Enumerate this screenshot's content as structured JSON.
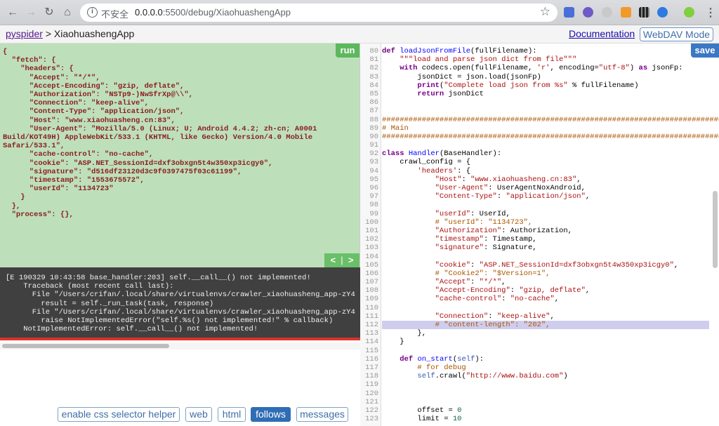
{
  "browser": {
    "security_label": "不安全",
    "url_host": "0.0.0.0",
    "url_rest": ":5500/debug/XiaohuashengApp",
    "extensions": [
      "jh-extension-icon",
      "w-extension-icon",
      "gear-extension-icon",
      "orange-extension-icon",
      "qr-code-extension-icon",
      "blue-globe-extension-icon",
      "profile-avatar-icon"
    ]
  },
  "header": {
    "breadcrumb_root": "pyspider",
    "breadcrumb_sep": ">",
    "project_name": "XiaohuashengApp",
    "documentation_link": "Documentation",
    "webdav_button": "WebDAV Mode"
  },
  "task_panel": {
    "run_label": "run",
    "pager_label": "<  |  >",
    "json_lines": [
      "{",
      "  \"fetch\": {",
      "    \"headers\": {",
      "      \"Accept\": \"*/*\",",
      "      \"Accept-Encoding\": \"gzip, deflate\",",
      "      \"Authorization\": \"NSTp9-)NwSfrXp@\\\\\",",
      "      \"Connection\": \"keep-alive\",",
      "      \"Content-Type\": \"application/json\",",
      "      \"Host\": \"www.xiaohuasheng.cn:83\",",
      "      \"User-Agent\": \"Mozilla/5.0 (Linux; U; Android 4.4.2; zh-cn; A0001",
      "Build/KOT49H) AppleWebKit/533.1 (KHTML, like Gecko) Version/4.0 Mobile",
      "Safari/533.1\",",
      "      \"cache-control\": \"no-cache\",",
      "      \"cookie\": \"ASP.NET_SessionId=dxf3obxgn5t4w350xp3icgy0\",",
      "      \"signature\": \"d516df23120d3c9f0397475f03c61199\",",
      "      \"timestamp\": \"1553675572\",",
      "      \"userId\": \"1134723\"",
      "    }",
      "  },",
      "  \"process\": {},"
    ]
  },
  "log_panel": {
    "lines": [
      "[E 190329 10:43:58 base_handler:203] self.__call__() not implemented!",
      "    Traceback (most recent call last):",
      "      File \"/Users/crifan/.local/share/virtualenvs/crawler_xiaohuasheng_app-zY4",
      "        result = self._run_task(task, response)",
      "      File \"/Users/crifan/.local/share/virtualenvs/crawler_xiaohuasheng_app-zY4",
      "        raise NotImplementedError(\"self.%s() not implemented!\" % callback)",
      "    NotImplementedError: self.__call__() not implemented!"
    ]
  },
  "bottom_tabs": [
    {
      "label": "enable css selector helper",
      "active": false
    },
    {
      "label": "web",
      "active": false
    },
    {
      "label": "html",
      "active": false
    },
    {
      "label": "follows",
      "active": true
    },
    {
      "label": "messages",
      "active": false
    }
  ],
  "editor": {
    "save_label": "save",
    "highlighted_line": 112,
    "line_numbers": [
      "80",
      "81",
      "82",
      "83",
      "84",
      "85",
      "86",
      "87",
      "88",
      "89",
      "90",
      "91",
      "92",
      "93",
      "94",
      "95",
      "96",
      "97",
      "98",
      "99",
      "100",
      "101",
      "102",
      "103",
      "104",
      "105",
      "106",
      "107",
      "108",
      "109",
      "110",
      "111",
      "112",
      "113",
      "114",
      "115",
      "116",
      "117",
      "118",
      "119",
      "120",
      "121",
      "122",
      "123"
    ],
    "code_lines": [
      "def loadJsonFromFile(fullFilename):",
      "    \"\"\"load and parse json dict from file\"\"\"",
      "    with codecs.open(fullFilename, 'r', encoding=\"utf-8\") as jsonFp:",
      "        jsonDict = json.load(jsonFp)",
      "        print(\"Complete load json from %s\" % fullFilename)",
      "        return jsonDict",
      "",
      "",
      "################################################################################",
      "# Main",
      "################################################################################",
      "",
      "class Handler(BaseHandler):",
      "    crawl_config = {",
      "        'headers': {",
      "            \"Host\": \"www.xiaohuasheng.cn:83\",",
      "            \"User-Agent\": UserAgentNoxAndroid,",
      "            \"Content-Type\": \"application/json\",",
      "",
      "            \"userId\": UserId,",
      "            # \"userId\": \"1134723\",",
      "            \"Authorization\": Authorization,",
      "            \"timestamp\": Timestamp,",
      "            \"signature\": Signature,",
      "",
      "            \"cookie\": \"ASP.NET_SessionId=dxf3obxgn5t4w350xp3icgy0\",",
      "            # \"Cookie2\": \"$Version=1\",",
      "            \"Accept\": \"*/*\",",
      "            \"Accept-Encoding\": \"gzip, deflate\",",
      "            \"cache-control\": \"no-cache\",",
      "",
      "            \"Connection\": \"keep-alive\",",
      "            # \"content-length\": \"202\",",
      "        },",
      "    }",
      "",
      "    def on_start(self):",
      "        # for debug",
      "        self.crawl(\"http://www.baidu.com\")",
      "",
      "",
      "",
      "        offset = 0",
      "        limit = 10"
    ]
  }
}
